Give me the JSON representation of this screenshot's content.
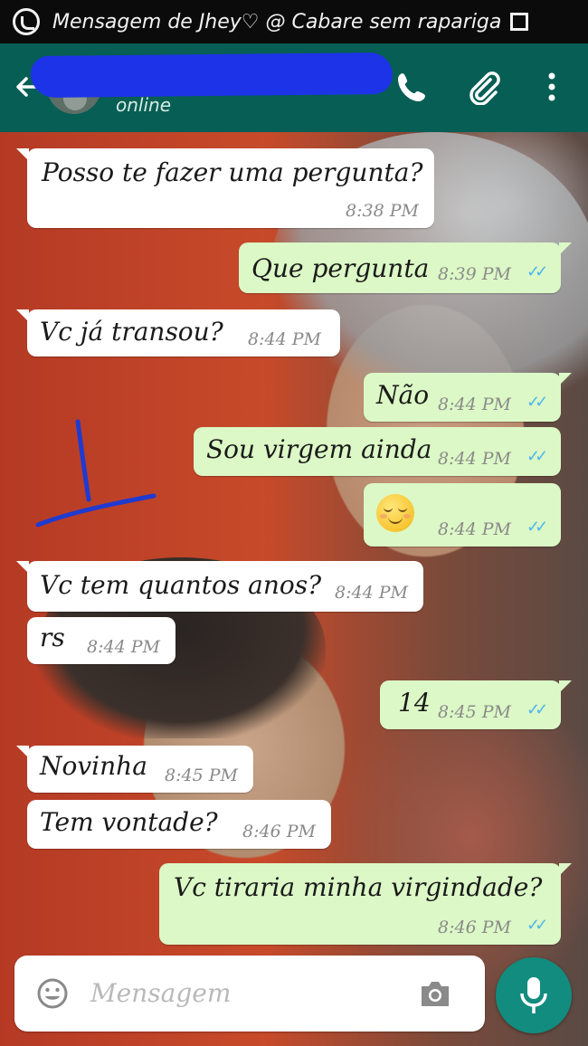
{
  "status_bar": {
    "notification": "Mensagem de Jhey♡ @ Cabare sem rapariga"
  },
  "header": {
    "contact_name": "",
    "status": "online",
    "icons": [
      "back-arrow-icon",
      "avatar",
      "phone-icon",
      "attach-icon",
      "more-icon"
    ],
    "color": "#075e54"
  },
  "messages": [
    {
      "dir": "in",
      "text": "Posso te fazer uma pergunta?",
      "time": "8:38 PM"
    },
    {
      "dir": "out",
      "text": "Que pergunta",
      "time": "8:39 PM"
    },
    {
      "dir": "in",
      "text": "Vc já transou?",
      "time": "8:44 PM"
    },
    {
      "dir": "out",
      "text": "Não",
      "time": "8:44 PM"
    },
    {
      "dir": "out",
      "text": "Sou virgem ainda",
      "time": "8:44 PM"
    },
    {
      "dir": "out",
      "text": "",
      "emoji": "relieved-face-icon",
      "time": "8:44 PM"
    },
    {
      "dir": "in",
      "text": "Vc tem quantos anos?",
      "time": "8:44 PM"
    },
    {
      "dir": "in",
      "text": "rs",
      "time": "8:44 PM"
    },
    {
      "dir": "out",
      "text": "14",
      "time": "8:45 PM"
    },
    {
      "dir": "in",
      "text": "Novinha",
      "time": "8:45 PM"
    },
    {
      "dir": "in",
      "text": "Tem vontade?",
      "time": "8:46 PM"
    },
    {
      "dir": "out",
      "text": "Vc tiraria minha virgindade?",
      "time": "8:46 PM"
    }
  ],
  "composer": {
    "placeholder": "Mensagem"
  },
  "colors": {
    "incoming": "#ffffff",
    "outgoing": "#dcf8c6",
    "read_ticks": "#4fb6ec",
    "fab": "#128c7e"
  }
}
